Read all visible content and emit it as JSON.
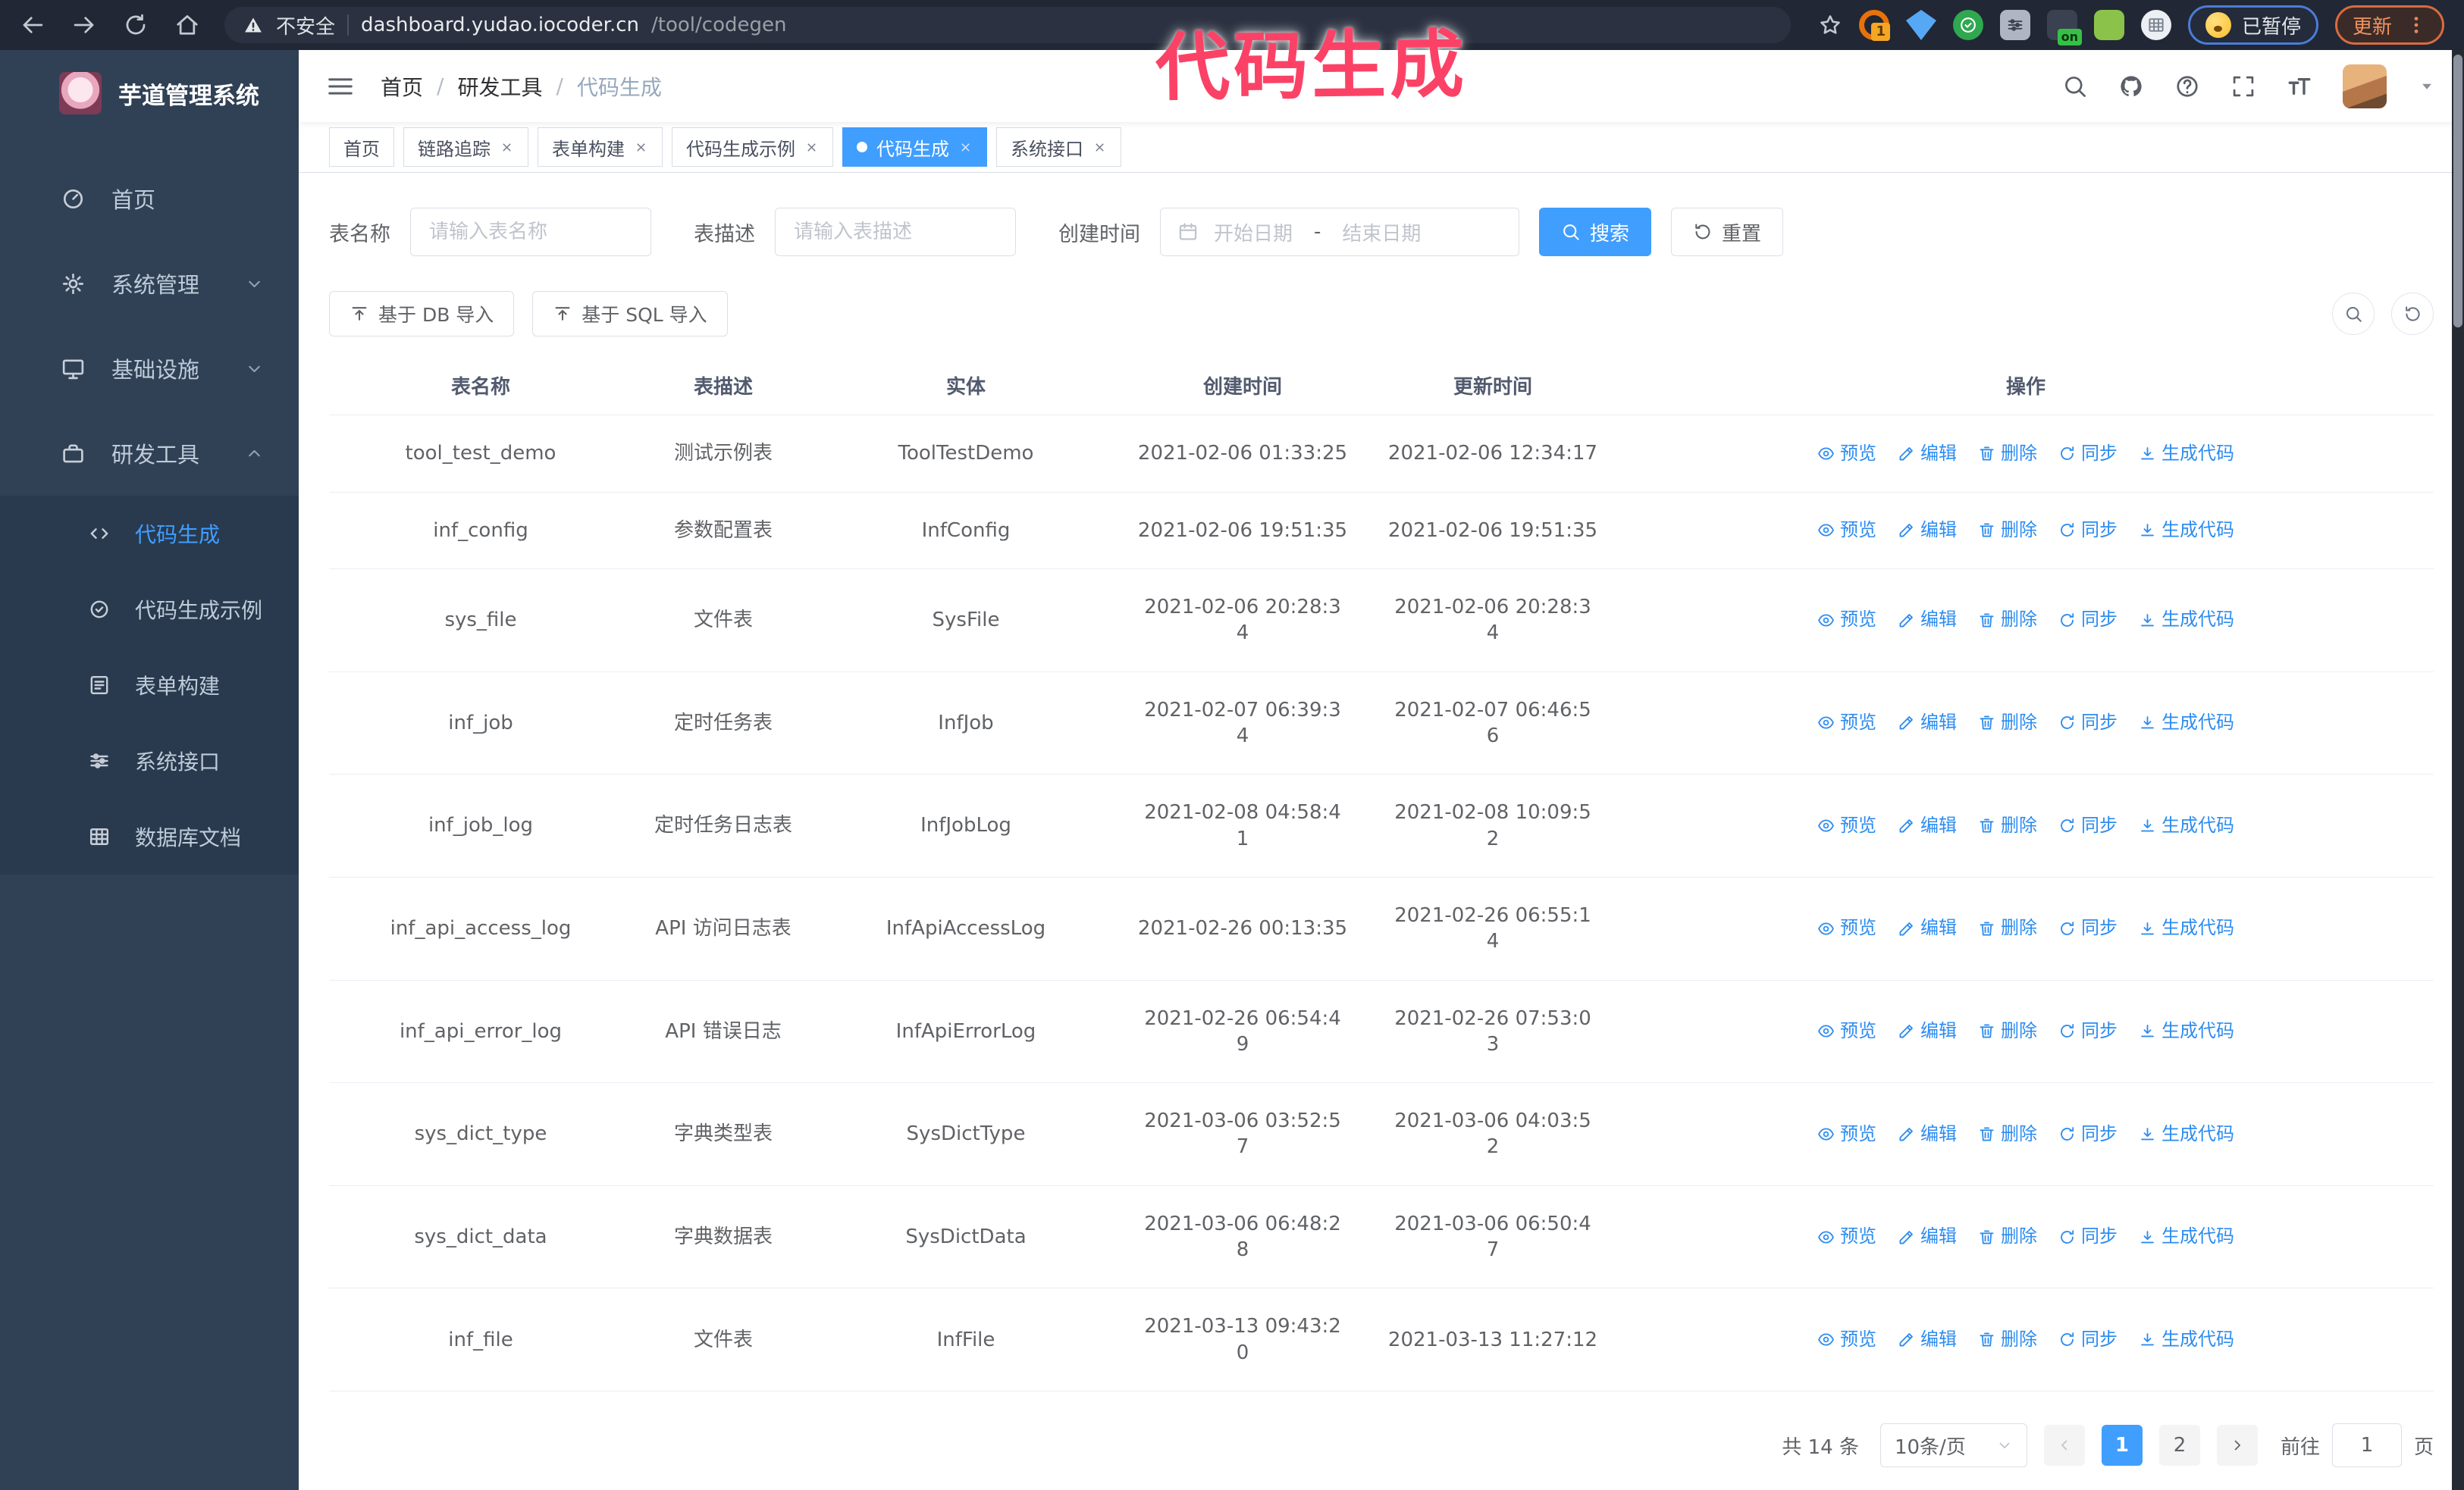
{
  "colors": {
    "accent": "#409EFF",
    "sidebar_bg": "#304156",
    "annotation_pink": "#fb4266",
    "link_blue": "#2d8cf0"
  },
  "browser": {
    "security_label": "不安全",
    "url_host": "dashboard.yudao.iocoder.cn",
    "url_path": "/tool/codegen",
    "extension_badge": "1",
    "extension_on_label": "on",
    "paused_label": "已暂停",
    "update_label": "更新"
  },
  "annotation": {
    "title": "代码生成"
  },
  "sidebar": {
    "app_title": "芋道管理系统",
    "items": [
      {
        "label": "首页"
      },
      {
        "label": "系统管理"
      },
      {
        "label": "基础设施"
      },
      {
        "label": "研发工具"
      }
    ],
    "submenu": [
      {
        "label": "代码生成"
      },
      {
        "label": "代码生成示例"
      },
      {
        "label": "表单构建"
      },
      {
        "label": "系统接口"
      },
      {
        "label": "数据库文档"
      }
    ]
  },
  "navbar": {
    "breadcrumb": [
      "首页",
      "研发工具",
      "代码生成"
    ],
    "separator": "/"
  },
  "tabs": [
    {
      "label": "首页"
    },
    {
      "label": "链路追踪"
    },
    {
      "label": "表单构建"
    },
    {
      "label": "代码生成示例"
    },
    {
      "label": "代码生成"
    },
    {
      "label": "系统接口"
    }
  ],
  "search_form": {
    "name_label": "表名称",
    "name_placeholder": "请输入表名称",
    "desc_label": "表描述",
    "desc_placeholder": "请输入表描述",
    "time_label": "创建时间",
    "start_placeholder": "开始日期",
    "range_separator": "-",
    "end_placeholder": "结束日期",
    "search_label": "搜索",
    "reset_label": "重置"
  },
  "toolbar": {
    "import_db_label": "基于 DB 导入",
    "import_sql_label": "基于 SQL 导入"
  },
  "table": {
    "headers": [
      "表名称",
      "表描述",
      "实体",
      "创建时间",
      "更新时间",
      "操作"
    ],
    "actions": [
      "预览",
      "编辑",
      "删除",
      "同步",
      "生成代码"
    ],
    "rows": [
      {
        "name": "tool_test_demo",
        "desc": "测试示例表",
        "entity": "ToolTestDemo",
        "created": "2021-02-06 01:33:25",
        "updated": "2021-02-06 12:34:17"
      },
      {
        "name": "inf_config",
        "desc": "参数配置表",
        "entity": "InfConfig",
        "created": "2021-02-06 19:51:35",
        "updated": "2021-02-06 19:51:35"
      },
      {
        "name": "sys_file",
        "desc": "文件表",
        "entity": "SysFile",
        "created": "2021-02-06 20:28:3\n4",
        "updated": "2021-02-06 20:28:3\n4"
      },
      {
        "name": "inf_job",
        "desc": "定时任务表",
        "entity": "InfJob",
        "created": "2021-02-07 06:39:3\n4",
        "updated": "2021-02-07 06:46:5\n6"
      },
      {
        "name": "inf_job_log",
        "desc": "定时任务日志表",
        "entity": "InfJobLog",
        "created": "2021-02-08 04:58:4\n1",
        "updated": "2021-02-08 10:09:5\n2"
      },
      {
        "name": "inf_api_access_log",
        "desc": "API 访问日志表",
        "entity": "InfApiAccessLog",
        "created": "2021-02-26 00:13:35",
        "updated": "2021-02-26 06:55:1\n4"
      },
      {
        "name": "inf_api_error_log",
        "desc": "API 错误日志",
        "entity": "InfApiErrorLog",
        "created": "2021-02-26 06:54:4\n9",
        "updated": "2021-02-26 07:53:0\n3"
      },
      {
        "name": "sys_dict_type",
        "desc": "字典类型表",
        "entity": "SysDictType",
        "created": "2021-03-06 03:52:5\n7",
        "updated": "2021-03-06 04:03:5\n2"
      },
      {
        "name": "sys_dict_data",
        "desc": "字典数据表",
        "entity": "SysDictData",
        "created": "2021-03-06 06:48:2\n8",
        "updated": "2021-03-06 06:50:4\n7"
      },
      {
        "name": "inf_file",
        "desc": "文件表",
        "entity": "InfFile",
        "created": "2021-03-13 09:43:2\n0",
        "updated": "2021-03-13 11:27:12"
      }
    ]
  },
  "pagination": {
    "total_label": "共 14 条",
    "page_size_label": "10条/页",
    "pages": [
      "1",
      "2"
    ],
    "goto_label": "前往",
    "goto_value": "1",
    "page_unit": "页"
  }
}
